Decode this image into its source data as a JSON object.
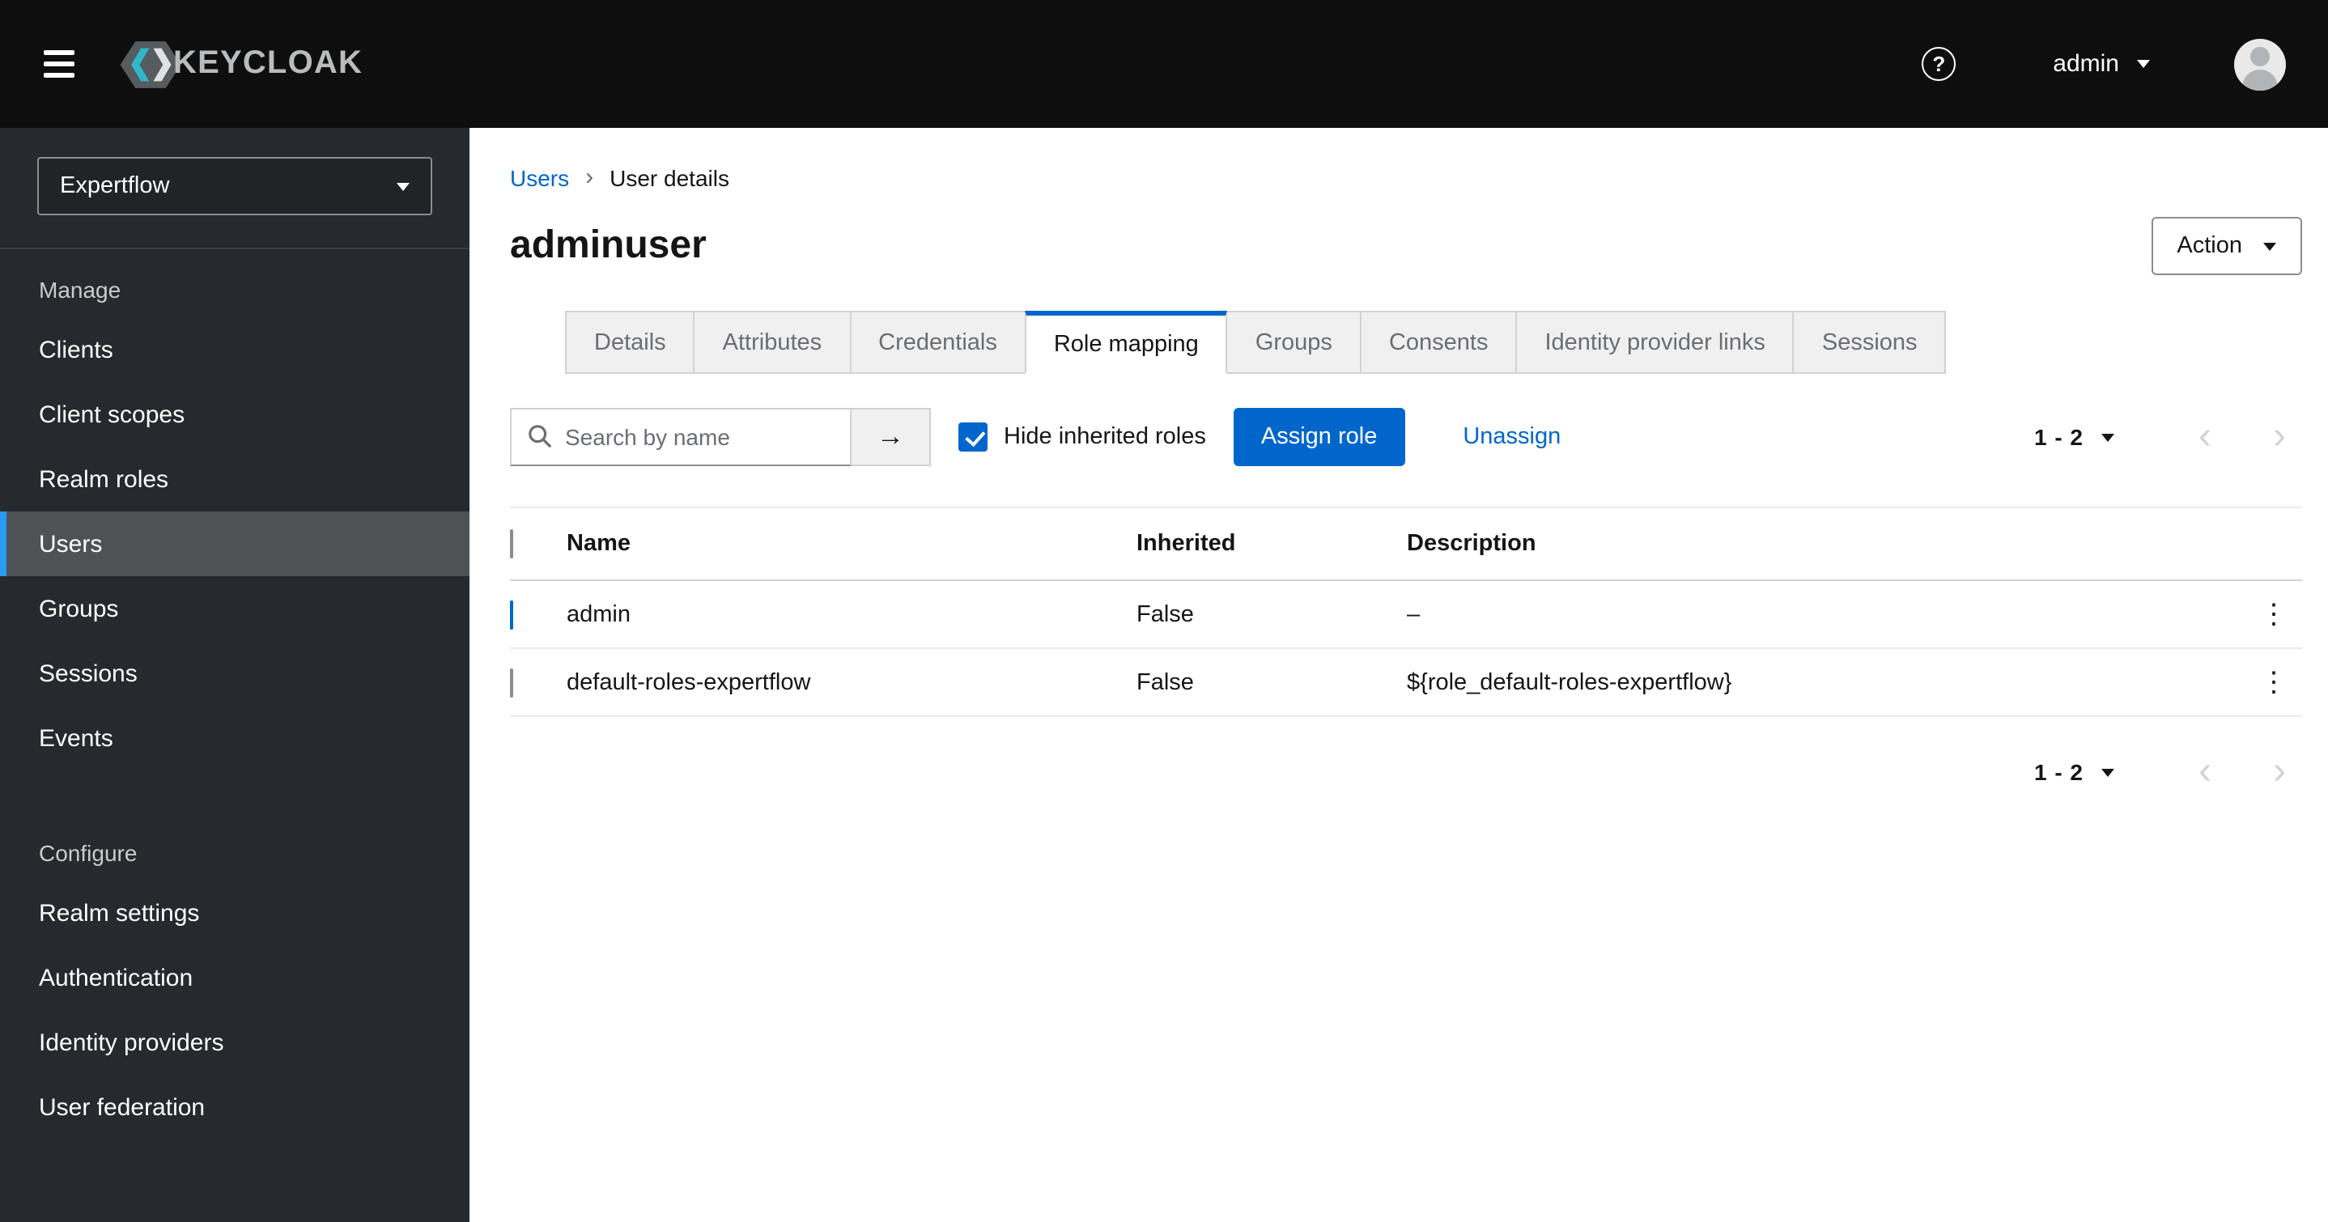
{
  "header": {
    "brand_text": "KEYCLOAK",
    "user_menu_label": "admin"
  },
  "icons": {
    "help": "?",
    "arrow_right": "→",
    "chevron_left": "‹",
    "chevron_right": "›",
    "kebab": "⋮"
  },
  "sidebar": {
    "realm_selector_value": "Expertflow",
    "sections": [
      {
        "label": "Manage",
        "items": [
          {
            "label": "Clients",
            "active": false
          },
          {
            "label": "Client scopes",
            "active": false
          },
          {
            "label": "Realm roles",
            "active": false
          },
          {
            "label": "Users",
            "active": true
          },
          {
            "label": "Groups",
            "active": false
          },
          {
            "label": "Sessions",
            "active": false
          },
          {
            "label": "Events",
            "active": false
          }
        ]
      },
      {
        "label": "Configure",
        "items": [
          {
            "label": "Realm settings",
            "active": false
          },
          {
            "label": "Authentication",
            "active": false
          },
          {
            "label": "Identity providers",
            "active": false
          },
          {
            "label": "User federation",
            "active": false
          }
        ]
      }
    ]
  },
  "breadcrumb": {
    "parent": "Users",
    "separator": "›",
    "current": "User details"
  },
  "page": {
    "title": "adminuser",
    "action_button_label": "Action"
  },
  "tabs": [
    {
      "label": "Details",
      "active": false
    },
    {
      "label": "Attributes",
      "active": false
    },
    {
      "label": "Credentials",
      "active": false
    },
    {
      "label": "Role mapping",
      "active": true
    },
    {
      "label": "Groups",
      "active": false
    },
    {
      "label": "Consents",
      "active": false
    },
    {
      "label": "Identity provider links",
      "active": false
    },
    {
      "label": "Sessions",
      "active": false
    }
  ],
  "toolbar": {
    "search_placeholder": "Search by name",
    "hide_inherited": {
      "label": "Hide inherited roles",
      "checked": true
    },
    "assign_role_label": "Assign role",
    "unassign_label": "Unassign",
    "pagination_range": "1 - 2"
  },
  "table": {
    "columns": {
      "name": "Name",
      "inherited": "Inherited",
      "description": "Description"
    },
    "rows": [
      {
        "checked": true,
        "name": "admin",
        "inherited": "False",
        "description": "–"
      },
      {
        "checked": false,
        "name": "default-roles-expertflow",
        "inherited": "False",
        "description": "${role_default-roles-expertflow}"
      }
    ]
  },
  "footer": {
    "pagination_range": "1 - 2"
  },
  "colors": {
    "primary": "#0066cc",
    "link": "#0066cc",
    "header_bg": "#0e0e0e",
    "sidebar_bg": "#26292d",
    "nav_active_bg": "#4f5255",
    "nav_active_indicator": "#2b9af3",
    "tab_inactive_bg": "#f0f0f0",
    "border": "#d2d2d2"
  }
}
